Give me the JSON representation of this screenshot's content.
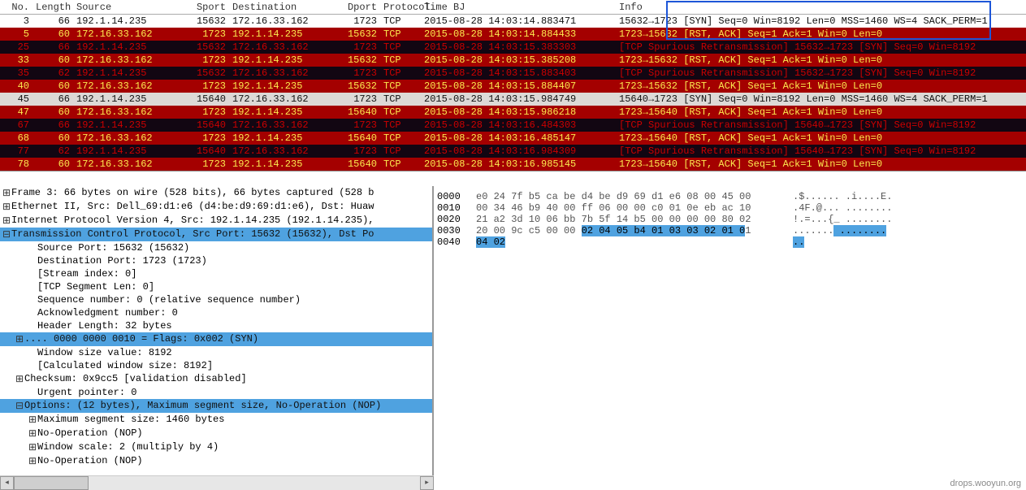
{
  "columns": {
    "no": "No.",
    "len": "Length",
    "src": "Source",
    "sport": "Sport",
    "dst": "Destination",
    "dport": "Dport",
    "proto": "Protocol",
    "time": "Time BJ",
    "info": "Info"
  },
  "rows": [
    {
      "no": "3",
      "len": "66",
      "src": "192.1.14.235",
      "sport": "15632",
      "dst": "172.16.33.162",
      "dport": "1723",
      "proto": "TCP",
      "time": "2015-08-28 14:03:14.883471",
      "info": "15632→1723 [SYN] Seq=0 Win=8192 Len=0 MSS=1460 WS=4 SACK_PERM=1",
      "cls": "row-white"
    },
    {
      "no": "5",
      "len": "60",
      "src": "172.16.33.162",
      "sport": "1723",
      "dst": "192.1.14.235",
      "dport": "15632",
      "proto": "TCP",
      "time": "2015-08-28 14:03:14.884433",
      "info": "1723→15632 [RST, ACK] Seq=1 Ack=1 Win=0 Len=0",
      "cls": "row-red"
    },
    {
      "no": "25",
      "len": "66",
      "src": "192.1.14.235",
      "sport": "15632",
      "dst": "172.16.33.162",
      "dport": "1723",
      "proto": "TCP",
      "time": "2015-08-28 14:03:15.383303",
      "info": "[TCP Spurious Retransmission] 15632→1723 [SYN] Seq=0 Win=8192",
      "cls": "row-dark"
    },
    {
      "no": "33",
      "len": "60",
      "src": "172.16.33.162",
      "sport": "1723",
      "dst": "192.1.14.235",
      "dport": "15632",
      "proto": "TCP",
      "time": "2015-08-28 14:03:15.385208",
      "info": "1723→15632 [RST, ACK] Seq=1 Ack=1 Win=0 Len=0",
      "cls": "row-red"
    },
    {
      "no": "35",
      "len": "62",
      "src": "192.1.14.235",
      "sport": "15632",
      "dst": "172.16.33.162",
      "dport": "1723",
      "proto": "TCP",
      "time": "2015-08-28 14:03:15.883403",
      "info": "[TCP Spurious Retransmission] 15632→1723 [SYN] Seq=0 Win=8192",
      "cls": "row-dark"
    },
    {
      "no": "40",
      "len": "60",
      "src": "172.16.33.162",
      "sport": "1723",
      "dst": "192.1.14.235",
      "dport": "15632",
      "proto": "TCP",
      "time": "2015-08-28 14:03:15.884407",
      "info": "1723→15632 [RST, ACK] Seq=1 Ack=1 Win=0 Len=0",
      "cls": "row-red"
    },
    {
      "no": "45",
      "len": "66",
      "src": "192.1.14.235",
      "sport": "15640",
      "dst": "172.16.33.162",
      "dport": "1723",
      "proto": "TCP",
      "time": "2015-08-28 14:03:15.984749",
      "info": "15640→1723 [SYN] Seq=0 Win=8192 Len=0 MSS=1460 WS=4 SACK_PERM=1",
      "cls": "row-gray"
    },
    {
      "no": "47",
      "len": "60",
      "src": "172.16.33.162",
      "sport": "1723",
      "dst": "192.1.14.235",
      "dport": "15640",
      "proto": "TCP",
      "time": "2015-08-28 14:03:15.986218",
      "info": "1723→15640 [RST, ACK] Seq=1 Ack=1 Win=0 Len=0",
      "cls": "row-red"
    },
    {
      "no": "67",
      "len": "66",
      "src": "192.1.14.235",
      "sport": "15640",
      "dst": "172.16.33.162",
      "dport": "1723",
      "proto": "TCP",
      "time": "2015-08-28 14:03:16.484303",
      "info": "[TCP Spurious Retransmission] 15640→1723 [SYN] Seq=0 Win=8192",
      "cls": "row-dark"
    },
    {
      "no": "68",
      "len": "60",
      "src": "172.16.33.162",
      "sport": "1723",
      "dst": "192.1.14.235",
      "dport": "15640",
      "proto": "TCP",
      "time": "2015-08-28 14:03:16.485147",
      "info": "1723→15640 [RST, ACK] Seq=1 Ack=1 Win=0 Len=0",
      "cls": "row-red"
    },
    {
      "no": "77",
      "len": "62",
      "src": "192.1.14.235",
      "sport": "15640",
      "dst": "172.16.33.162",
      "dport": "1723",
      "proto": "TCP",
      "time": "2015-08-28 14:03:16.984309",
      "info": "[TCP Spurious Retransmission] 15640→1723 [SYN] Seq=0 Win=8192",
      "cls": "row-dark"
    },
    {
      "no": "78",
      "len": "60",
      "src": "172.16.33.162",
      "sport": "1723",
      "dst": "192.1.14.235",
      "dport": "15640",
      "proto": "TCP",
      "time": "2015-08-28 14:03:16.985145",
      "info": "1723→15640 [RST, ACK] Seq=1 Ack=1 Win=0 Len=0",
      "cls": "row-red"
    }
  ],
  "tree": [
    {
      "tw": "⊞",
      "ind": 0,
      "txt": "Frame 3: 66 bytes on wire (528 bits), 66 bytes captured (528 b"
    },
    {
      "tw": "⊞",
      "ind": 0,
      "txt": "Ethernet II, Src: Dell_69:d1:e6 (d4:be:d9:69:d1:e6), Dst: Huaw"
    },
    {
      "tw": "⊞",
      "ind": 0,
      "txt": "Internet Protocol Version 4, Src: 192.1.14.235 (192.1.14.235),"
    },
    {
      "tw": "⊟",
      "ind": 0,
      "txt": "Transmission Control Protocol, Src Port: 15632 (15632), Dst Po",
      "hl": true
    },
    {
      "tw": "",
      "ind": 2,
      "txt": "Source Port: 15632 (15632)"
    },
    {
      "tw": "",
      "ind": 2,
      "txt": "Destination Port: 1723 (1723)"
    },
    {
      "tw": "",
      "ind": 2,
      "txt": "[Stream index: 0]"
    },
    {
      "tw": "",
      "ind": 2,
      "txt": "[TCP Segment Len: 0]"
    },
    {
      "tw": "",
      "ind": 2,
      "txt": "Sequence number: 0    (relative sequence number)"
    },
    {
      "tw": "",
      "ind": 2,
      "txt": "Acknowledgment number: 0"
    },
    {
      "tw": "",
      "ind": 2,
      "txt": "Header Length: 32 bytes"
    },
    {
      "tw": "⊞",
      "ind": 1,
      "txt": ".... 0000 0000 0010 = Flags: 0x002 (SYN)",
      "hl": true
    },
    {
      "tw": "",
      "ind": 2,
      "txt": "Window size value: 8192"
    },
    {
      "tw": "",
      "ind": 2,
      "txt": "[Calculated window size: 8192]"
    },
    {
      "tw": "⊞",
      "ind": 1,
      "txt": "Checksum: 0x9cc5 [validation disabled]"
    },
    {
      "tw": "",
      "ind": 2,
      "txt": "Urgent pointer: 0"
    },
    {
      "tw": "⊟",
      "ind": 1,
      "txt": "Options: (12 bytes), Maximum segment size, No-Operation (NOP)",
      "hl": true
    },
    {
      "tw": "⊞",
      "ind": 2,
      "txt": "Maximum segment size: 1460 bytes"
    },
    {
      "tw": "⊞",
      "ind": 2,
      "txt": "No-Operation (NOP)"
    },
    {
      "tw": "⊞",
      "ind": 2,
      "txt": "Window scale: 2 (multiply by 4)"
    },
    {
      "tw": "⊞",
      "ind": 2,
      "txt": "No-Operation (NOP)"
    }
  ],
  "hex": [
    {
      "off": "0000",
      "b": "e0 24 7f b5 ca be d4 be  d9 69 d1 e6 08 00 45 00",
      "a": ".$...... .i....E."
    },
    {
      "off": "0010",
      "b": "00 34 46 b9 40 00 ff 06  00 00 c0 01 0e eb ac 10",
      "a": ".4F.@... ........"
    },
    {
      "off": "0020",
      "b": "21 a2 3d 10 06 bb 7b 5f  14 b5 00 00 00 00 80 02",
      "a": "!.=...{_ ........"
    },
    {
      "off": "0030",
      "b": "20 00 9c c5 00 00 02 04  05 b4 01 03 03 02 01 01",
      "a": " ....... ........",
      "sel": [
        18,
        47
      ],
      "asel": [
        8,
        17
      ]
    },
    {
      "off": "0040",
      "b": "04 02",
      "a": "..",
      "sel": [
        0,
        5
      ],
      "asel": [
        0,
        2
      ]
    }
  ],
  "watermark": "drops.wooyun.org"
}
